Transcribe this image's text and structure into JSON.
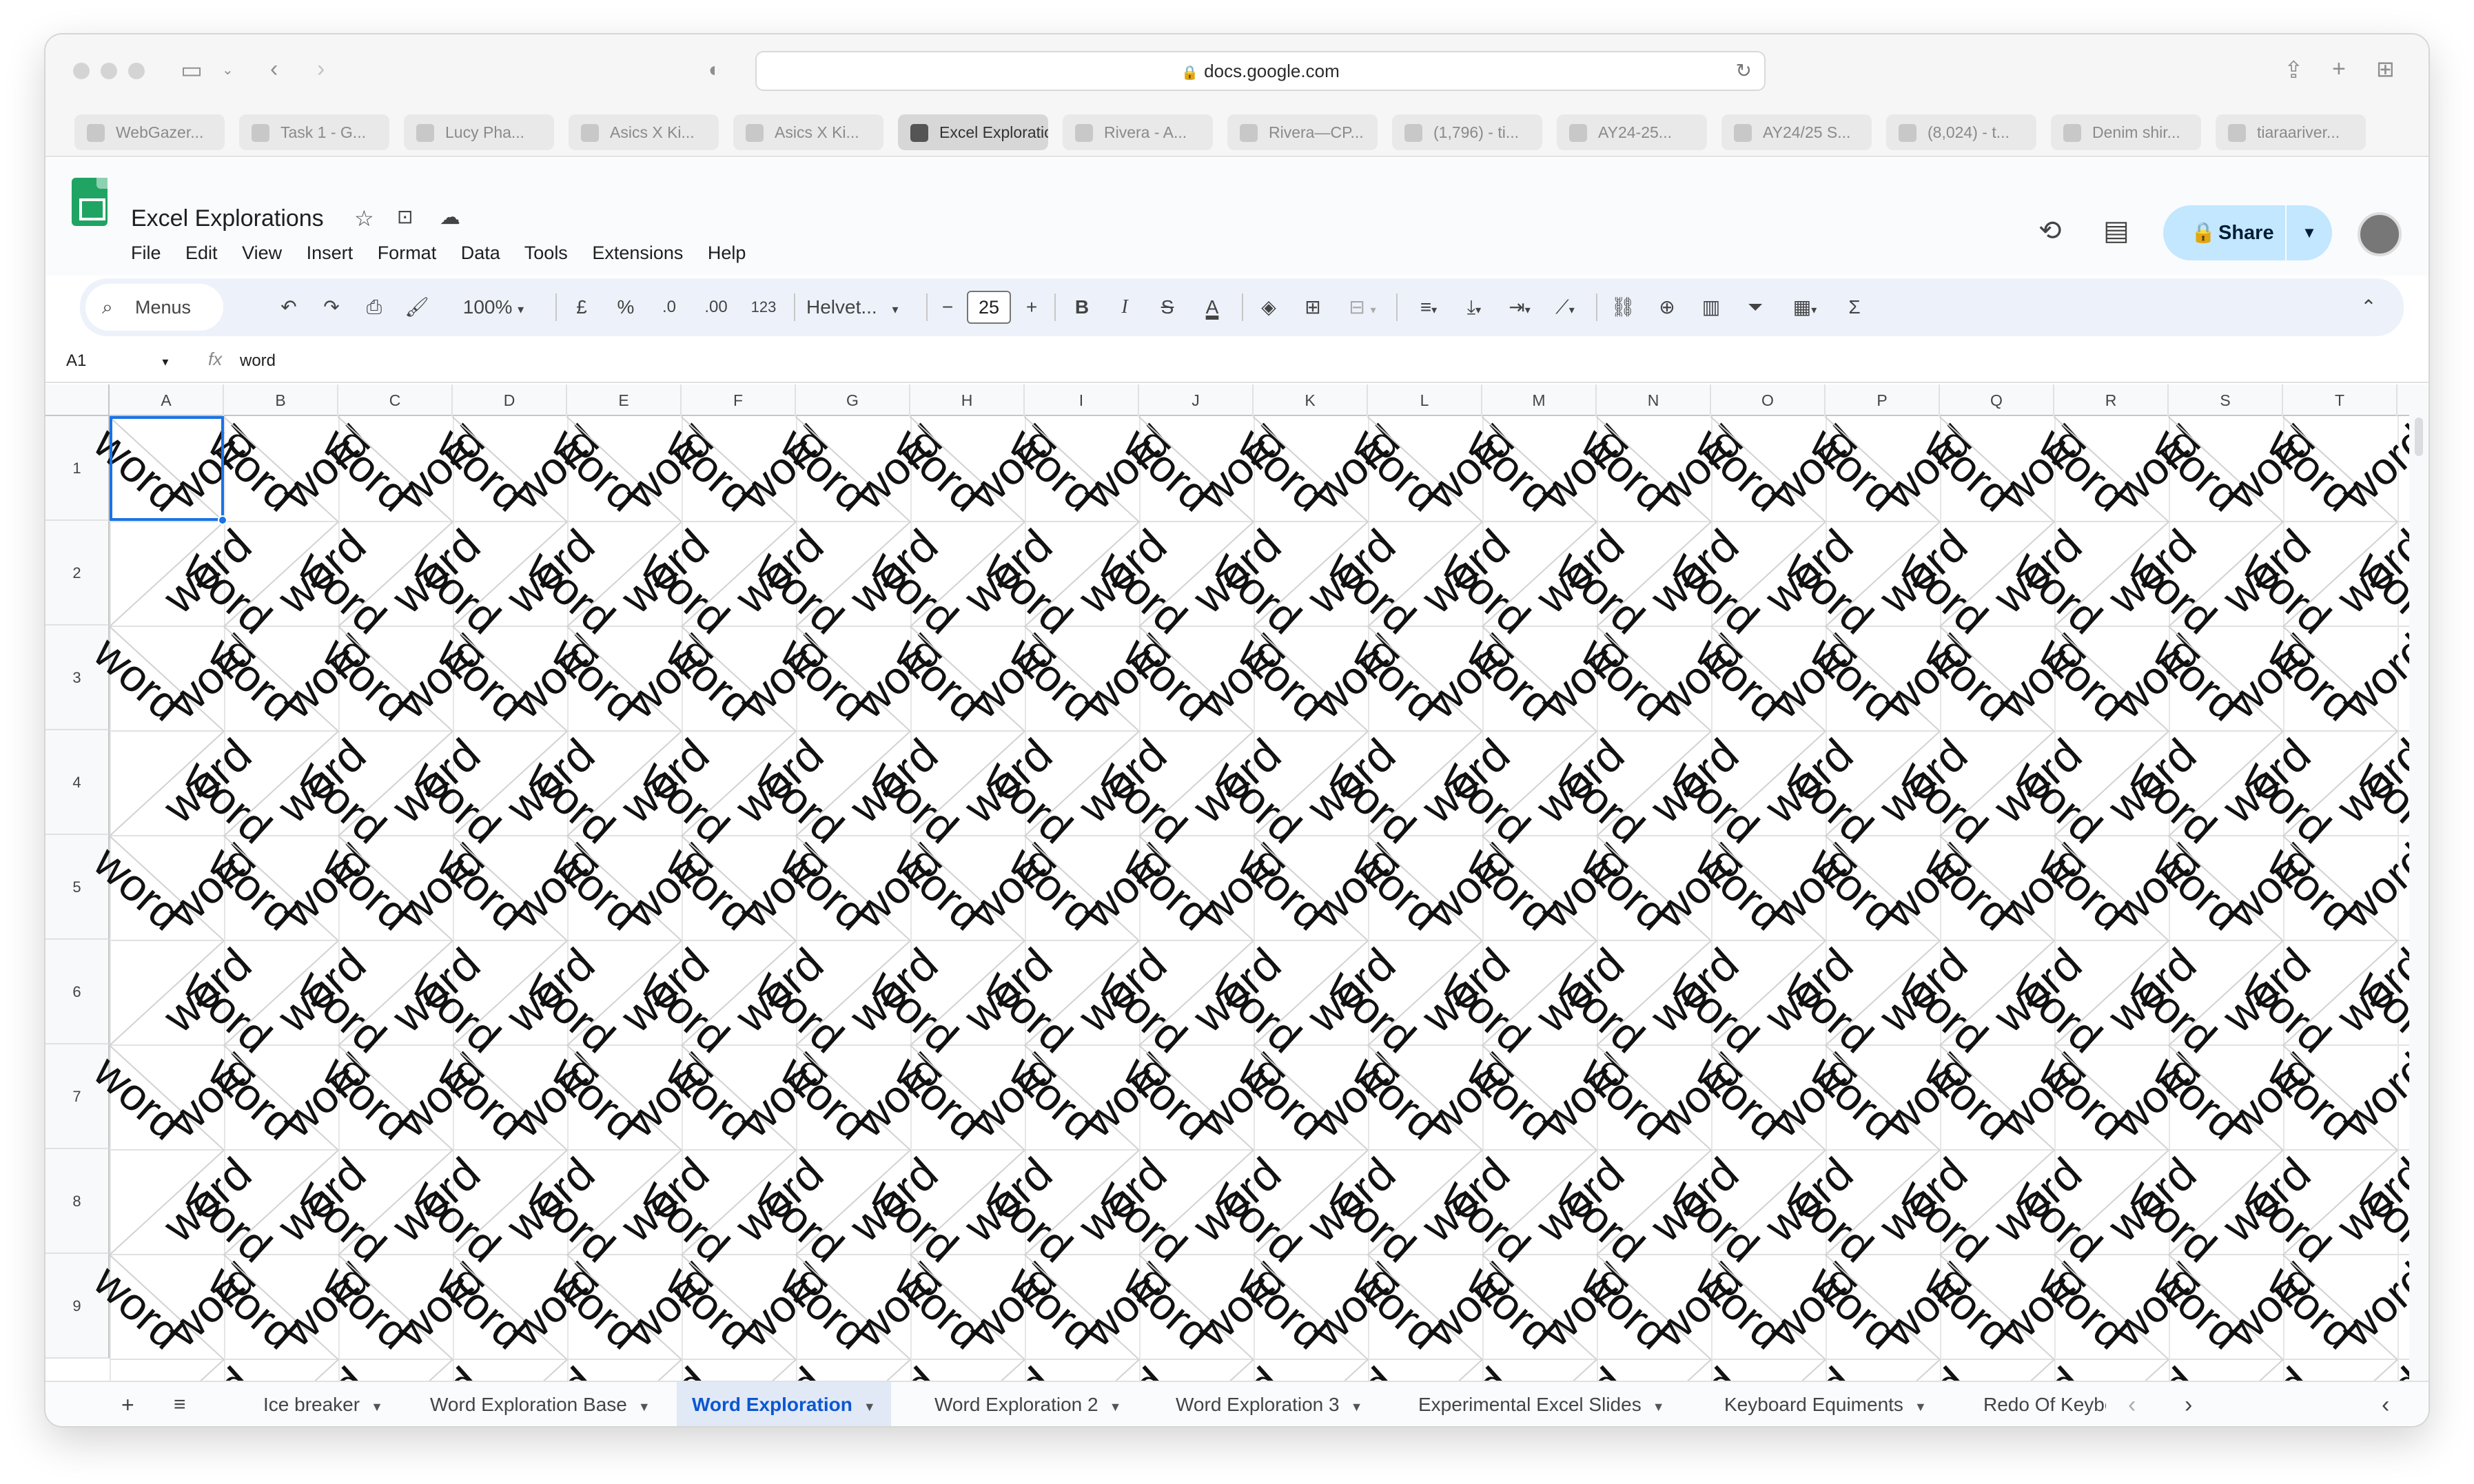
{
  "browser": {
    "url": "docs.google.com",
    "tabs": [
      {
        "label": "WebGazer..."
      },
      {
        "label": "Task 1 - G..."
      },
      {
        "label": "Lucy Pha..."
      },
      {
        "label": "Asics X Ki..."
      },
      {
        "label": "Asics X Ki..."
      },
      {
        "label": "Excel Exploration...",
        "active": true
      },
      {
        "label": "Rivera - A..."
      },
      {
        "label": "Rivera—CP..."
      },
      {
        "label": "(1,796) - ti..."
      },
      {
        "label": "AY24-25..."
      },
      {
        "label": "AY24/25 S..."
      },
      {
        "label": "(8,024) - t..."
      },
      {
        "label": "Denim shir..."
      },
      {
        "label": "tiaraariver..."
      }
    ]
  },
  "doc": {
    "title": "Excel Explorations",
    "menu": [
      "File",
      "Edit",
      "View",
      "Insert",
      "Format",
      "Data",
      "Tools",
      "Extensions",
      "Help"
    ],
    "share_label": "Share"
  },
  "toolbar": {
    "menus_label": "Menus",
    "zoom": "100%",
    "currency": "£",
    "percent": "%",
    "dec_decrease": ".0",
    "dec_increase": ".00",
    "format_123": "123",
    "font": "Helvet...",
    "font_size": "25",
    "bold": "B",
    "italic": "I",
    "strike": "S",
    "text_color": "A"
  },
  "formula_bar": {
    "cell_ref": "A1",
    "fx": "fx",
    "value": "word"
  },
  "grid": {
    "columns": [
      "A",
      "B",
      "C",
      "D",
      "E",
      "F",
      "G",
      "H",
      "I",
      "J",
      "K",
      "L",
      "M",
      "N",
      "O",
      "P",
      "Q",
      "R",
      "S",
      "T"
    ],
    "rows": [
      "1",
      "2",
      "3",
      "4",
      "5",
      "6",
      "7",
      "8",
      "9"
    ],
    "cell_text": "word",
    "selected_cell": "A1"
  },
  "sheet_tabs": [
    {
      "label": "Ice breaker"
    },
    {
      "label": "Word Exploration Base"
    },
    {
      "label": "Word Exploration",
      "active": true
    },
    {
      "label": "Word Exploration 2"
    },
    {
      "label": "Word Exploration 3"
    },
    {
      "label": "Experimental Excel Slides"
    },
    {
      "label": "Keyboard Equiments"
    },
    {
      "label": "Redo Of Keybo"
    }
  ],
  "colors": {
    "accent": "#1a73e8",
    "share_bg": "#c2e7ff",
    "sheets_green": "#1fa463",
    "active_tab_text": "#0b57d0"
  },
  "icons": [
    "sidebar-icon",
    "back-icon",
    "forward-icon",
    "shield-icon",
    "lock-icon",
    "reload-icon",
    "share-sheet-icon",
    "new-tab-icon",
    "tab-overview-icon",
    "star-icon",
    "folder-icon",
    "cloud-icon",
    "history-icon",
    "comment-icon",
    "search-icon",
    "undo-icon",
    "redo-icon",
    "print-icon",
    "paint-format-icon",
    "fill-color-icon",
    "borders-icon",
    "merge-icon",
    "align-icon",
    "valign-icon",
    "wrap-icon",
    "rotate-icon",
    "link-icon",
    "add-comment-icon",
    "chart-icon",
    "filter-icon",
    "table-icon",
    "sum-icon",
    "collapse-icon"
  ]
}
